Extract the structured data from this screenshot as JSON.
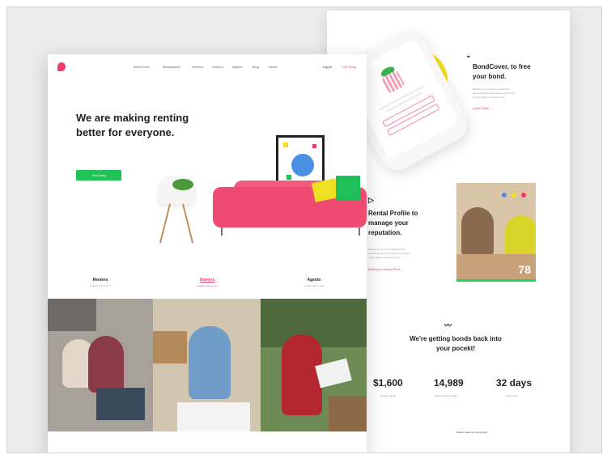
{
  "front": {
    "nav": {
      "items": [
        "BondCover",
        "Marketplace",
        "Renters",
        "Owners",
        "Agents",
        "Blog",
        "About"
      ],
      "login": "Log In",
      "signup": "Get Snug"
    },
    "hero": {
      "title": "We are making renting better for everyone.",
      "cta": "Get Snug"
    },
    "tabs": [
      {
        "label": "Renters",
        "sub": "a faster way to rent"
      },
      {
        "label": "Owners",
        "sub": "a faster way to rent"
      },
      {
        "label": "Agents",
        "sub": "a faster way to rent"
      }
    ]
  },
  "back": {
    "bond": {
      "title": "BondCover, to free your bond.",
      "body": "BondCover is a bond replacement product that lets you access your bond money before you leave to go.",
      "link": "Learn More"
    },
    "rental": {
      "title": "Rental Profile to manage your reputation.",
      "body": "BondCover is a bond replacement product that lets you access your bond money before you leave to go.",
      "link": "Build your Rental Prof.",
      "score": "78"
    },
    "bonds": {
      "title": "We're getting bonds back into your pocekt!",
      "stats": [
        {
          "value": "$1,600",
          "label": "average refund"
        },
        {
          "value": "14,989",
          "label": "bonds helped to date"
        },
        {
          "value": "32 days",
          "label": "return time"
        }
      ],
      "footer": "What is new from snug blog?"
    }
  },
  "colors": {
    "accent_pink": "#ef3b6c",
    "accent_green": "#21c356",
    "accent_yellow": "#f6e01c"
  }
}
